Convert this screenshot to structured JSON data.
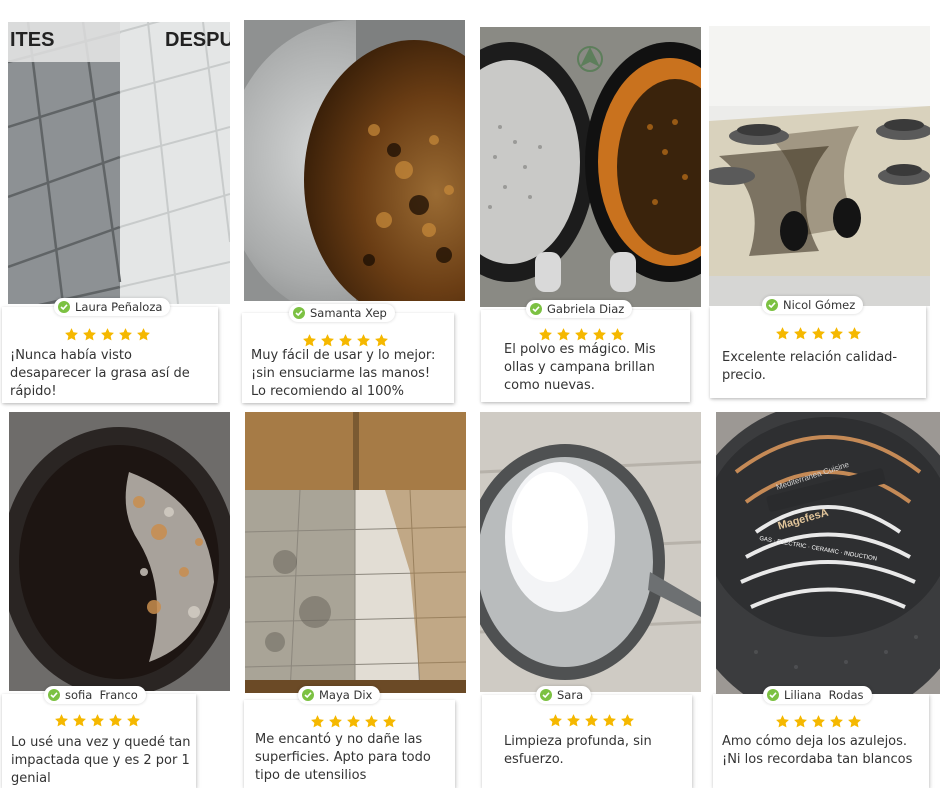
{
  "reviews": [
    {
      "name": "Laura Peñaloza",
      "text": "¡Nunca había visto\ndesaparecer la grasa así de\nrápido!",
      "rating": 5,
      "photo": "tiled-floor-before-after",
      "photo_labels": {
        "left": "ITES",
        "right": "DESPU"
      }
    },
    {
      "name": "Samanta Xep",
      "text": "Muy fácil de usar y lo mejor:\n¡sin ensuciarme las manos!\nLo recomiendo al 100%",
      "rating": 5,
      "photo": "pot-before-after"
    },
    {
      "name": "Gabriela Diaz",
      "text": "El polvo es mágico. Mis\nollas y campana brillan\ncomo nuevas.",
      "rating": 5,
      "photo": "pans-before-after"
    },
    {
      "name": "Nicol Gómez",
      "text": "Excelente relación calidad-\nprecio.",
      "rating": 5,
      "photo": "stovetop"
    },
    {
      "name": "sofia  Franco",
      "text": "Lo usé una vez y quedé tan\nimpactada que y es 2 por 1\ngenial",
      "rating": 5,
      "photo": "burnt-pan"
    },
    {
      "name": "Maya Dix",
      "text": "Me encantó y no dañe las\nsuperficies. Apto para todo\ntipo de utensilios",
      "rating": 5,
      "photo": "kitchen-floor"
    },
    {
      "name": "Sara",
      "text": "Limpieza profunda, sin\nesfuerzo.",
      "rating": 5,
      "photo": "pan-with-powder"
    },
    {
      "name": "Liliana  Rodas",
      "text": "Amo cómo deja los azulejos.\n¡Ni los recordaba tan blancos",
      "rating": 5,
      "photo": "pan-bottom",
      "photo_labels": {
        "brand": "MagefesA",
        "model": "Mediterranea Cuisine",
        "band": "GAS · ELECTRIC · CERAMIC · INDUCTION"
      }
    }
  ],
  "colors": {
    "star": "#f5b800",
    "check": "#7cc142"
  }
}
